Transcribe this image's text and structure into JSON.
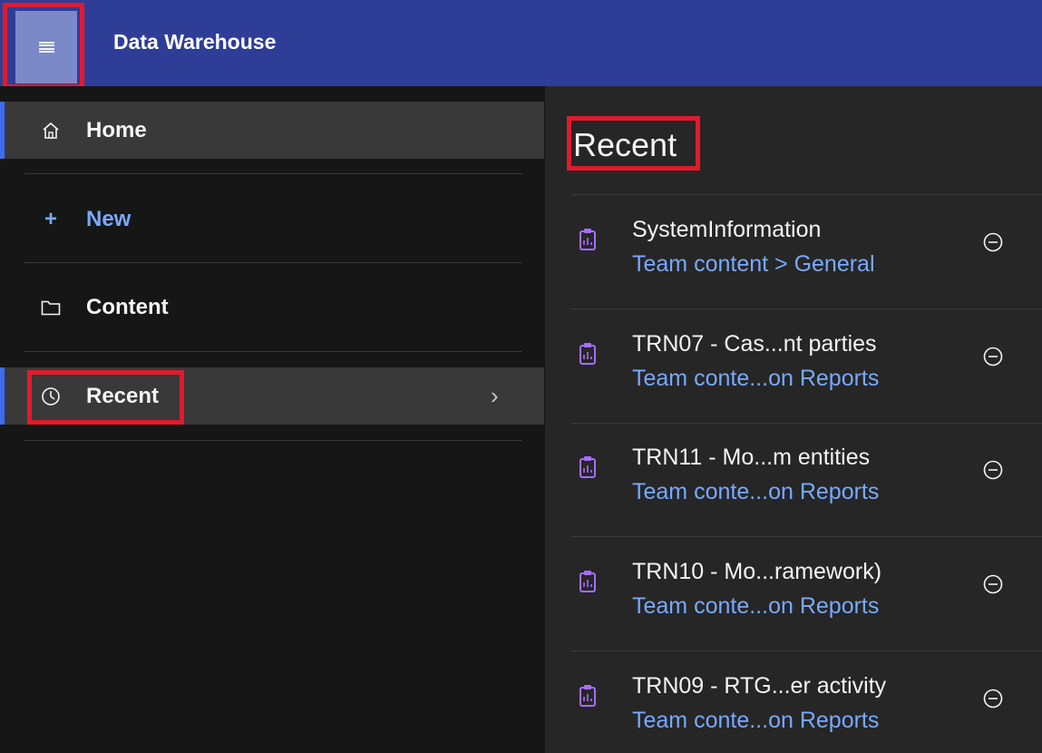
{
  "app": {
    "title": "Data Warehouse"
  },
  "sidebar": {
    "items": [
      {
        "label": "Home",
        "icon": "home-icon"
      },
      {
        "label": "New",
        "icon": "plus-icon"
      },
      {
        "label": "Content",
        "icon": "folder-icon"
      },
      {
        "label": "Recent",
        "icon": "clock-icon",
        "chevron": "›"
      }
    ],
    "plus_glyph": "+"
  },
  "recent": {
    "title": "Recent",
    "items": [
      {
        "name": "SystemInformation",
        "path": "Team content > General"
      },
      {
        "name": "TRN07 - Cas...nt parties",
        "path": "Team conte...on Reports"
      },
      {
        "name": "TRN11 - Mo...m entities",
        "path": "Team conte...on Reports"
      },
      {
        "name": "TRN10 - Mo...ramework)",
        "path": "Team conte...on Reports"
      },
      {
        "name": "TRN09 - RTG...er activity",
        "path": "Team conte...on Reports"
      }
    ]
  },
  "colors": {
    "header": "#2e3e96",
    "accent_blue": "#78a9ff",
    "selection_bar": "#3d6cf0",
    "highlight_red": "#e21a2c",
    "report_icon": "#a56eff"
  }
}
